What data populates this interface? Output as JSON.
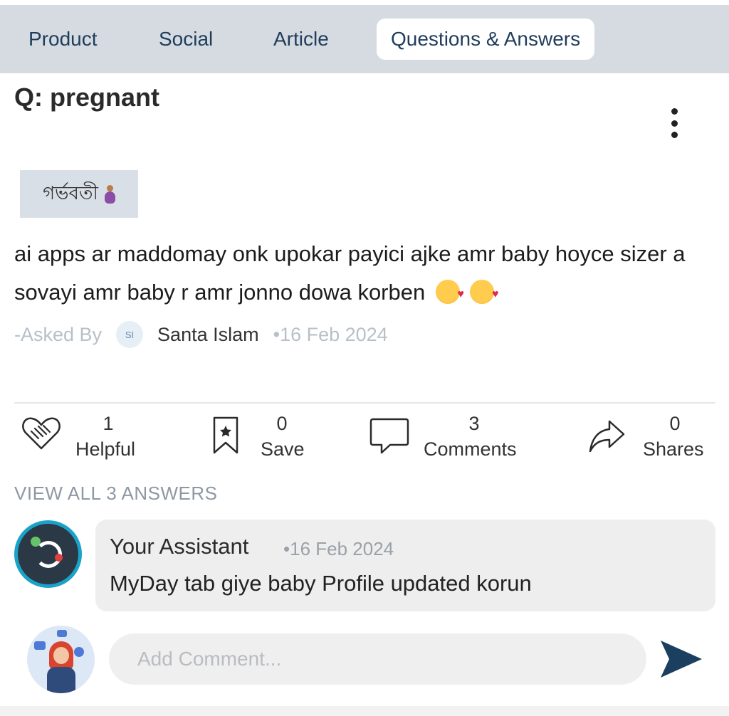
{
  "tabs": [
    {
      "label": "Product",
      "active": false
    },
    {
      "label": "Social",
      "active": false
    },
    {
      "label": "Article",
      "active": false
    },
    {
      "label": "Questions & Answers",
      "active": true
    }
  ],
  "question": {
    "title": "Q: pregnant",
    "tag": "গর্ভবতী",
    "tag_icon": "pregnant-woman-emoji",
    "body": "ai apps ar maddomay onk upokar payici ajke amr baby hoyce sizer a sovayi amr baby r amr jonno dowa korben",
    "body_emojis": [
      "smiling-face-with-hearts",
      "smiling-face-with-hearts"
    ],
    "asked_by_label": "-Asked By",
    "author_initials": "SI",
    "author_name": "Santa Islam",
    "date": "•16 Feb 2024"
  },
  "actions": [
    {
      "icon": "handshake-heart-icon",
      "count": "1",
      "label": "Helpful"
    },
    {
      "icon": "bookmark-star-icon",
      "count": "0",
      "label": "Save"
    },
    {
      "icon": "comment-icon",
      "count": "3",
      "label": "Comments"
    },
    {
      "icon": "share-arrow-icon",
      "count": "0",
      "label": "Shares"
    }
  ],
  "view_all_label": "VIEW ALL 3 ANSWERS",
  "answer": {
    "author": "Your Assistant",
    "date": "•16 Feb 2024",
    "text": "MyDay tab giye baby Profile updated korun"
  },
  "comment_input": {
    "placeholder": "Add Comment..."
  },
  "colors": {
    "tabbar_bg": "#d5dbe1",
    "tab_text": "#1f3d5c",
    "send_arrow": "#1b3f5e",
    "bubble_bg": "#eeeeee"
  }
}
